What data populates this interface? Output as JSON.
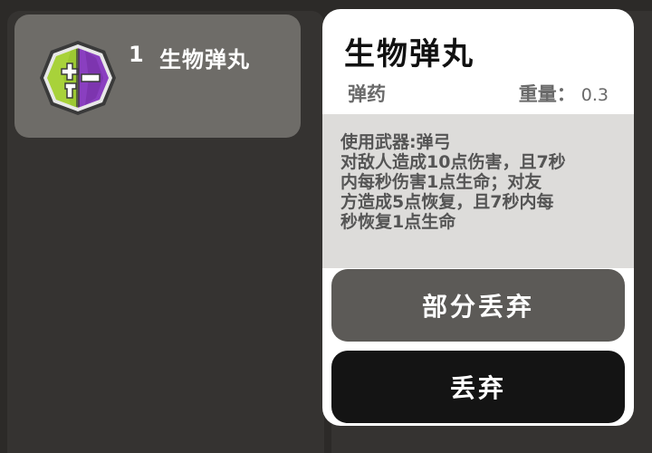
{
  "inventory": {
    "items": [
      {
        "index": "1",
        "name": "生物弹丸",
        "icon": "bio-pellet-icon"
      }
    ]
  },
  "detail": {
    "title": "生物弹丸",
    "type": "弹药",
    "weight_label": "重量：",
    "weight_value": "0.3",
    "description": "使用武器:弹弓\n对敌人造成10点伤害，且7秒\n内每秒伤害1点生命；对友\n方造成5点恢复，且7秒内每\n秒恢复1点生命"
  },
  "actions": {
    "partial_drop_label": "部分丢弃",
    "drop_label": "丢弃"
  },
  "colors": {
    "icon_green": "#a8d23a",
    "icon_purple": "#8a3fc0",
    "slot_bg": "#6e6c68",
    "partial_button": "#5c5a57",
    "drop_button": "#141414"
  }
}
